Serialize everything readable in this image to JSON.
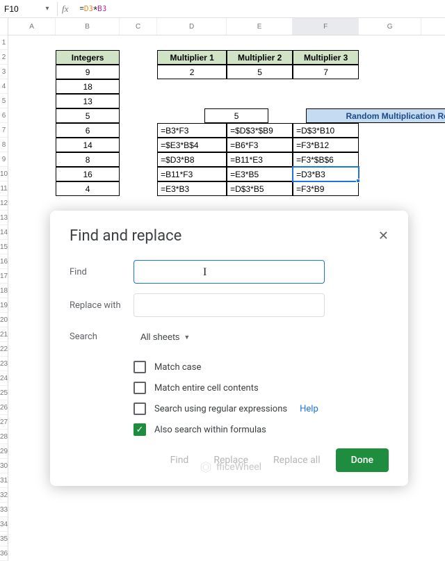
{
  "cell_ref": "F10",
  "formula_parts": {
    "eq": "=",
    "d3": "D3",
    "star": "*",
    "b3": "B3"
  },
  "columns": [
    "A",
    "B",
    "C",
    "D",
    "E",
    "F",
    "G"
  ],
  "rows_visible": 36,
  "integers_header": "Integers",
  "integers": [
    "9",
    "18",
    "13",
    "5",
    "6",
    "14",
    "8",
    "16",
    "4"
  ],
  "multipliers_headers": [
    "Multiplier 1",
    "Multiplier 2",
    "Multiplier 3"
  ],
  "multipliers_values": [
    "2",
    "5",
    "7"
  ],
  "results_header": "Random Multiplication Results",
  "results": [
    [
      "=B3*F3",
      "=$D$3*$B9",
      "=D$3*B10"
    ],
    [
      "=$E3*B$4",
      "=B6*F3",
      "=F3*B12"
    ],
    [
      "=$D3*B8",
      "=B11*E3",
      "=F3*$B$6"
    ],
    [
      "=B11*F3",
      "=E3*B5",
      "=D3*B3"
    ],
    [
      "=E3*B3",
      "=D$3*B5",
      "=F3*B9"
    ]
  ],
  "dialog": {
    "title": "Find and replace",
    "find_label": "Find",
    "replace_label": "Replace with",
    "search_label": "Search",
    "search_scope": "All sheets",
    "match_case": "Match case",
    "match_entire": "Match entire cell contents",
    "regex": "Search using regular expressions",
    "help": "Help",
    "within_formulas": "Also search within formulas",
    "btn_find": "Find",
    "btn_replace": "Replace",
    "btn_replace_all": "Replace all",
    "btn_done": "Done"
  },
  "watermark": "fficeWheel"
}
